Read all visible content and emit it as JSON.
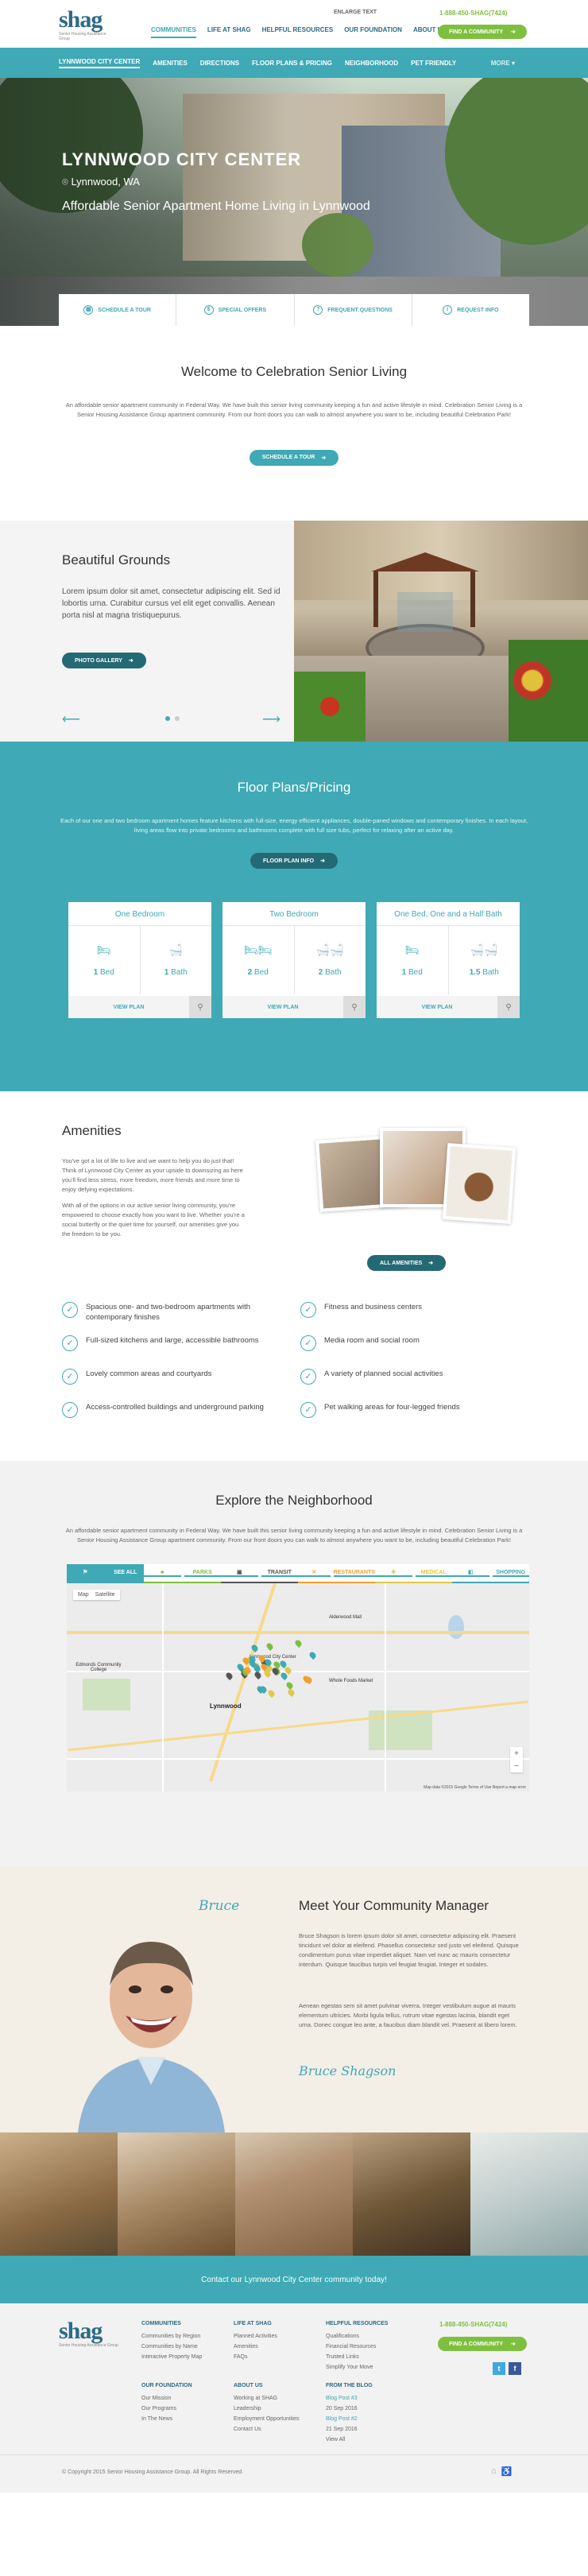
{
  "header": {
    "logo_text": "shag",
    "logo_sub": "Senior Housing Assistance Group",
    "enlarge_text": "ENLARGE TEXT",
    "phone": "1-888-450-SHAG(7424)",
    "nav": [
      "COMMUNITIES",
      "LIFE AT SHAG",
      "HELPFUL RESOURCES",
      "OUR FOUNDATION",
      "ABOUT US"
    ],
    "cta": "FIND A COMMUNITY",
    "cta_arrow": "➜"
  },
  "subnav": {
    "items": [
      "LYNNWOOD CITY CENTER",
      "AMENITIES",
      "DIRECTIONS",
      "FLOOR PLANS & PRICING",
      "NEIGHBORHOOD",
      "PET FRIENDLY"
    ],
    "more": "MORE ▾"
  },
  "hero": {
    "title": "LYNNWOOD CITY CENTER",
    "location_icon": "⌾",
    "location": "Lynnwood, WA",
    "tagline": "Affordable Senior Apartment Home Living in Lynnwood",
    "actions": [
      {
        "icon": "▦",
        "label": "SCHEDULE A TOUR"
      },
      {
        "icon": "$",
        "label": "SPECIAL OFFERS"
      },
      {
        "icon": "?",
        "label": "FREQUENT QUESTIONS"
      },
      {
        "icon": "i",
        "label": "REQUEST INFO"
      }
    ]
  },
  "welcome": {
    "title": "Welcome to Celebration Senior Living",
    "body": "An affordable senior apartment community in Federal Way. We have built this senior living community keeping a fun and active lifestyle in mind. Celebration Senior Living is a Senior Housing Assistance Group apartment community. From our front doors you can walk to almost anywhere you want to be, including beautiful Celebration Park!",
    "button": "SCHEDULE A TOUR"
  },
  "grounds": {
    "title": "Beautiful Grounds",
    "body": "Lorem ipsum dolor sit amet, consectetur adipiscing elit. Sed id lobortis urna. Curabitur cursus vel elit eget convallis. Aenean porta nisl at magna tristiquepurus.",
    "button": "PHOTO GALLERY",
    "prev": "⟵",
    "next": "⟶"
  },
  "floor": {
    "title": "Floor Plans/Pricing",
    "body": "Each of our one and two bedroom apartment homes feature kitchens with full-size, energy efficient appliances, double-paned windows and contemporary finishes. In each layout, living areas flow into private bedrooms and bathrooms complete with full size tubs, perfect for relaxing after an active day.",
    "button": "FLOOR PLAN INFO",
    "plans": [
      {
        "name": "One Bedroom",
        "bed_icon": "🛏",
        "bath_icon": "🛁",
        "bed_count": "1",
        "bath_count": "1",
        "bed_label": "Bed",
        "bath_label": "Bath",
        "action": "VIEW PLAN",
        "zoom": "⚲"
      },
      {
        "name": "Two Bedroom",
        "bed_icon": "🛏🛏",
        "bath_icon": "🛁🛁",
        "bed_count": "2",
        "bath_count": "2",
        "bed_label": "Bed",
        "bath_label": "Bath",
        "action": "VIEW PLAN",
        "zoom": "⚲"
      },
      {
        "name": "One Bed, One and a Half Bath",
        "bed_icon": "🛏",
        "bath_icon": "🛁🛁",
        "bed_count": "1",
        "bath_count": "1.5",
        "bed_label": "Bed",
        "bath_label": "Bath",
        "action": "VIEW PLAN",
        "zoom": "⚲"
      }
    ]
  },
  "amenities": {
    "title": "Amenities",
    "intro1": "You've got a lot of life to live and we want to help you do just that! Think of Lynnwood City Center as your upside to downsizing as here you'll find less stress, more freedom, more friends and more time to enjoy defying expectations.",
    "intro2": "With all of the options in our active senior living community, you're empowered to choose exactly how you want to live. Whether you're a social butterfly or the quiet time for yourself, our amenities give you the freedom to be you.",
    "button": "ALL AMENITIES",
    "items": [
      "Spacious one- and two-bedroom apartments with contemporary finishes",
      "Fitness and business centers",
      "Full-sized kitchens and large, accessible bathrooms",
      "Media room and social room",
      "Lovely common areas and courtyards",
      "A variety of planned social activities",
      "Access-controlled buildings and underground parking",
      "Pet walking areas for four-legged friends"
    ],
    "check_icon": "✓"
  },
  "neighborhood": {
    "title": "Explore the Neighborhood",
    "body": "An affordable senior apartment community in Federal Way. We have built this senior living community keeping a fun and active lifestyle in mind. Celebration Senior Living is a Senior Housing Assistance Group apartment community. From our front doors you can walk to almost anywhere you want to be, including beautiful Celebration Park!",
    "tabs": [
      "SEE ALL",
      "PARKS",
      "TRANSIT",
      "RESTAURANTS",
      "MEDICAL",
      "SHOPPING"
    ],
    "tab_colors": [
      "#3fa9b5",
      "#7fbf3f",
      "#555555",
      "#f0a030",
      "#e0c84a",
      "#3fa9b5"
    ],
    "map_controls": [
      "Map",
      "Satellite"
    ],
    "map_labels": [
      "Lynnwood City Center",
      "Whole Foods Market",
      "Alderwood Mall",
      "Lynnwood",
      "Edmonds Community College"
    ],
    "map_footer": "Map data ©2015 Google   Terms of Use   Report a map error"
  },
  "manager": {
    "name_script": "Bruce",
    "title": "Meet Your Community Manager",
    "body1": "Bruce Shagson is lorem ipsum dolor sit amet, consectetur adipiscing elit. Praesent tincidunt vel dolor at eleifend. Phasellus consectetur sed justo vel eleifend. Quisque condimentum purus vitae imperdiet aliquet. Nam vel nunc ac mauris consectetur interdum. Quisque faucibus turpis vel feugiat feugiat. Integer et sodales.",
    "body2": "Aenean egestas sem sit amet pulvinar viverra. Integer vestibulum augue at mauris elementum ultricies. Morbi ligula tellus, rutrum vitae egestas lacinia, blandit eget urna. Donec congue leo ante, a faucibus diam blandit vel. Praesent at libero lorem.",
    "signature": "Bruce Shagson"
  },
  "cta_banner": "Contact our Lynnwood City Center community today!",
  "footer": {
    "columns": [
      {
        "title": "COMMUNITIES",
        "links": [
          "Communities by Region",
          "Communities by Name",
          "Interactive Property Map"
        ]
      },
      {
        "title": "LIFE AT SHAG",
        "links": [
          "Planned Activities",
          "Amenities",
          "FAQs"
        ]
      },
      {
        "title": "HELPFUL RESOURCES",
        "links": [
          "Qualifications",
          "Financial Resources",
          "Trusted Links",
          "Simplify Your Move"
        ]
      },
      {
        "title": "OUR FOUNDATION",
        "links": [
          "Our Mission",
          "Our Programs",
          "In The News"
        ]
      },
      {
        "title": "ABOUT US",
        "links": [
          "Working at SHAG",
          "Leadership",
          "Employment Opportunities",
          "Contact Us"
        ]
      },
      {
        "title": "FROM THE BLOG",
        "links": [
          "Blog Post #3",
          "20 Sep 2016",
          "Blog Post #2",
          "21 Sep 2016",
          "View All"
        ]
      }
    ],
    "phone": "1-888-450-SHAG(7424)",
    "cta": "FIND A COMMUNITY",
    "cta_arrow": "➜",
    "social": [
      "t",
      "f"
    ],
    "copyright": "© Copyright 2015 Senior Housing Assistance Group. All Rights Reserved.",
    "bottom_icons": [
      "⌂",
      "♿"
    ]
  }
}
